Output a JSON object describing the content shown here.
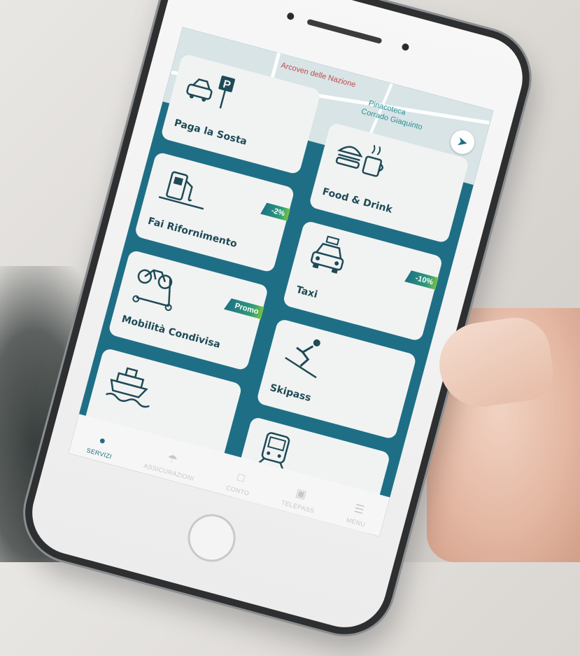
{
  "map": {
    "poi_name_line1": "Pinacoteca",
    "poi_name_line2": "Corrado Giaquinto",
    "street_label": "Arcoven delle Nazione"
  },
  "tiles": [
    {
      "label": "Paga la Sosta",
      "icon": "parking-car-icon",
      "badge": ""
    },
    {
      "label": "Food & Drink",
      "icon": "burger-coffee-icon",
      "badge": ""
    },
    {
      "label": "Fai Rifornimento",
      "icon": "fuel-pump-icon",
      "badge": "-2%"
    },
    {
      "label": "Taxi",
      "icon": "taxi-icon",
      "badge": "-10%"
    },
    {
      "label": "Mobilità Condivisa",
      "icon": "bike-scooter-icon",
      "badge": "Promo"
    },
    {
      "label": "Skipass",
      "icon": "skier-icon",
      "badge": ""
    },
    {
      "label": "",
      "icon": "ferry-icon",
      "badge": ""
    },
    {
      "label": "",
      "icon": "train-icon",
      "badge": ""
    }
  ],
  "tabbar": [
    {
      "label": "SERVIZI",
      "icon": "map-pin-icon",
      "active": true
    },
    {
      "label": "ASSICURAZIONI",
      "icon": "umbrella-icon",
      "active": false
    },
    {
      "label": "CONTO",
      "icon": "wallet-icon",
      "active": false
    },
    {
      "label": "TELEPASS",
      "icon": "telepass-icon",
      "active": false
    },
    {
      "label": "MENU",
      "icon": "menu-icon",
      "active": false
    }
  ],
  "colors": {
    "accent": "#1e6f86",
    "tile_bg": "#f1f3f2",
    "badge_green": "#79c243"
  }
}
